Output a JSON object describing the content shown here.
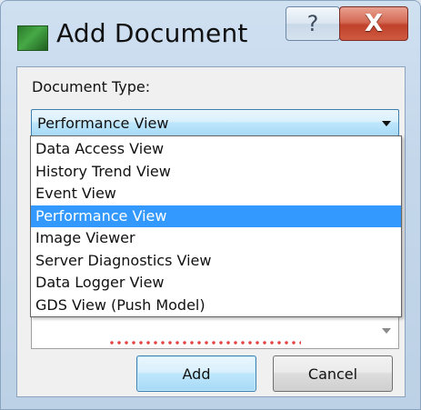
{
  "window": {
    "title": "Add Document",
    "help_glyph": "?",
    "close_glyph": "X"
  },
  "form": {
    "document_type_label": "Document Type:",
    "document_type_selected": "Performance View"
  },
  "dropdown": {
    "selected_index": 3,
    "items": [
      {
        "label": "Data Access View"
      },
      {
        "label": "History Trend View"
      },
      {
        "label": "Event View"
      },
      {
        "label": "Performance View"
      },
      {
        "label": "Image Viewer"
      },
      {
        "label": "Server Diagnostics View"
      },
      {
        "label": "Data Logger View"
      },
      {
        "label": "GDS View (Push Model)"
      }
    ]
  },
  "buttons": {
    "add_label": "Add",
    "cancel_label": "Cancel"
  },
  "icons": {
    "app": "green-document-icon",
    "help": "help-icon",
    "close": "close-icon",
    "combo_arrow": "chevron-down-icon"
  },
  "colors": {
    "selection": "#3399ff",
    "close_button": "#c0422c",
    "accent_border": "#3c7fb1"
  }
}
